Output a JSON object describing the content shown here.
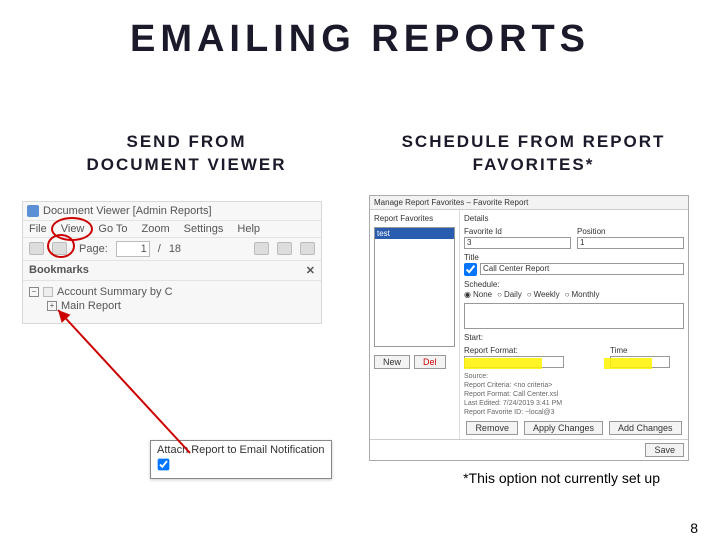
{
  "slide": {
    "title": "EMAILING REPORTS",
    "pageNumber": "8",
    "footnote": "*This option not currently set up"
  },
  "col_left": {
    "heading_line1": "SEND FROM",
    "heading_line2": "DOCUMENT VIEWER"
  },
  "col_right": {
    "heading_line1": "SCHEDULE FROM REPORT",
    "heading_line2": "FAVORITES*"
  },
  "docviewer": {
    "title": "Document Viewer [Admin Reports]",
    "menu": {
      "file": "File",
      "view": "View",
      "goto": "Go To",
      "zoom": "Zoom",
      "settings": "Settings",
      "help": "Help"
    },
    "toolbar": {
      "page_label": "Page:",
      "page_current": "1",
      "page_sep": "/",
      "page_total": "18"
    },
    "bookmarks_label": "Bookmarks",
    "tree": {
      "root": "Account Summary by C",
      "child": "Main Report"
    }
  },
  "attach": {
    "label": "Attach Report to Email Notification",
    "checked": true
  },
  "favwin": {
    "title": "Manage Report Favorites – Favorite Report",
    "left_label": "Report Favorites",
    "selected_favorite": "test",
    "btn_new": "New",
    "btn_delete": "Del",
    "details_label": "Details",
    "favoriteid_label": "Favorite Id",
    "favoriteid_value": "3",
    "position_label": "Position",
    "position_value": "1",
    "title_label": "Title",
    "title_value": "Call Center Report",
    "schedule_label": "Schedule:",
    "radios": {
      "none": "None",
      "daily": "Daily",
      "weekly": "Weekly",
      "monthly": "Monthly"
    },
    "start_label": "Start:",
    "reportformat_label": "Report Format:",
    "reportformat_value": "",
    "time_label": "Time",
    "time_value": "",
    "src_block": "Source:\nReport Criteria: <no criteria>\nReport Format: Call Center.xsl\nLast Edited: 7/24/2019 3:41 PM\nReport Favorite ID: ~local@3",
    "btn_remove": "Remove",
    "btn_apply": "Apply Changes",
    "btn_add": "Add Changes",
    "btn_save": "Save"
  }
}
